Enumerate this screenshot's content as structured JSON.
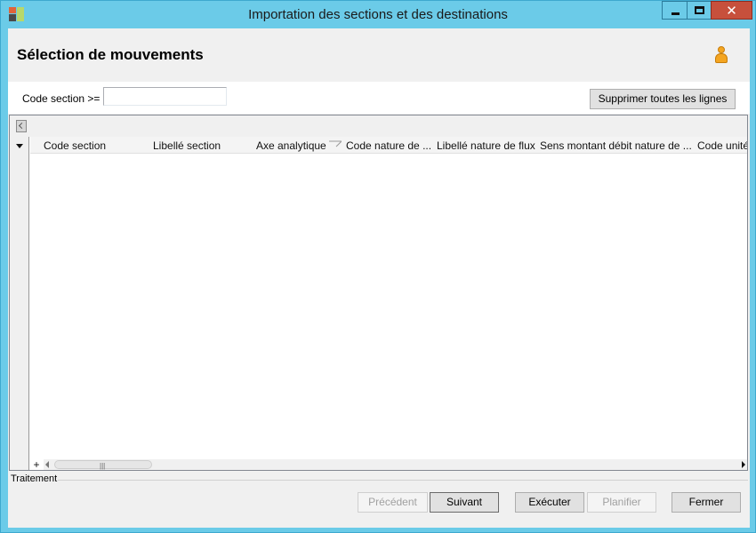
{
  "window": {
    "title": "Importation des sections et des destinations"
  },
  "header": {
    "title": "Sélection de mouvements",
    "user_icon": "user-icon"
  },
  "filter": {
    "label": "Code section >=",
    "value": "",
    "clear_all_label": "Supprimer toutes les lignes"
  },
  "grid": {
    "columns": [
      "Code section",
      "Libellé section",
      "Axe analytique",
      "Code nature de ...",
      "Libellé nature de flux",
      "Sens montant débit nature de ...",
      "Code unité"
    ],
    "add_row_symbol": "+",
    "rows": []
  },
  "footer": {
    "section_label": "Traitement",
    "buttons": {
      "previous": "Précédent",
      "next": "Suivant",
      "execute": "Exécuter",
      "schedule": "Planifier",
      "close": "Fermer"
    }
  },
  "colors": {
    "window_frame": "#6bcbe8",
    "close_button": "#c7503c",
    "user_icon": "#f4a521"
  }
}
